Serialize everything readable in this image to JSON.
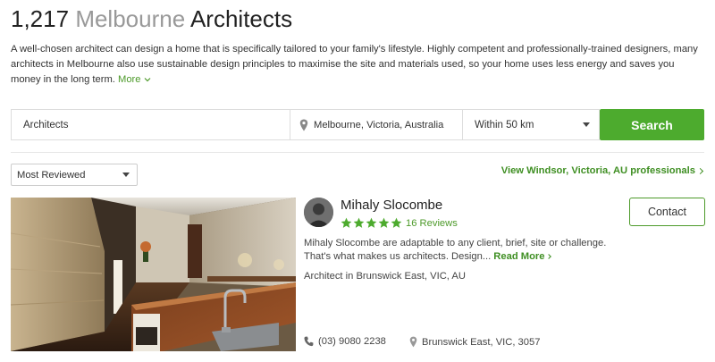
{
  "header": {
    "count": "1,217",
    "city": "Melbourne",
    "category": "Architects"
  },
  "description": {
    "text": "A well-chosen architect can design a home that is specifically tailored to your family's lifestyle. Highly competent and professionally-trained designers, many architects in Melbourne also use sustainable design principles to maximise the site and materials used, so your home uses less energy and saves you money in the long term.",
    "more_label": "More"
  },
  "search": {
    "keyword": "Architects",
    "location": "Melbourne, Victoria, Australia",
    "radius": "Within 50 km",
    "button_label": "Search"
  },
  "filters": {
    "sort": "Most Reviewed",
    "view_link": "View Windsor, Victoria, AU professionals"
  },
  "listing": {
    "name": "Mihaly Slocombe",
    "rating": 5,
    "reviews": "16 Reviews",
    "contact_label": "Contact",
    "blurb": "Mihaly Slocombe are adaptable to any client, brief, site or challenge. That's what makes us architects. Design...",
    "read_more": "Read More",
    "location": "Architect in Brunswick East, VIC, AU",
    "phone": "(03) 9080 2238",
    "address": "Brunswick East, VIC, 3057"
  },
  "colors": {
    "accent": "#4dab2e",
    "link": "#3f8f23",
    "star": "#4dab2e"
  }
}
